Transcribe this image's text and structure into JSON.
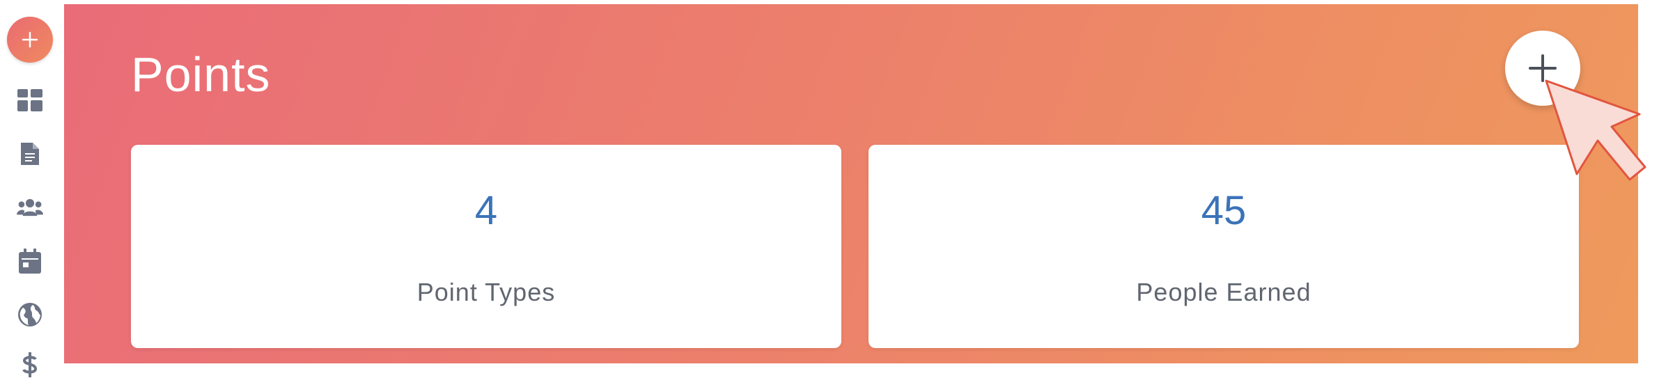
{
  "sidebar": {
    "add_icon": "plus-icon",
    "items": [
      {
        "icon": "dashboard-icon"
      },
      {
        "icon": "document-icon"
      },
      {
        "icon": "people-icon"
      },
      {
        "icon": "calendar-icon"
      },
      {
        "icon": "globe-icon"
      },
      {
        "icon": "dollar-icon"
      }
    ],
    "icon_color": "#6b7385"
  },
  "header": {
    "title": "Points",
    "add_icon": "plus-icon"
  },
  "stats": [
    {
      "value": "4",
      "label": "Point Types"
    },
    {
      "value": "45",
      "label": "People Earned"
    }
  ],
  "colors": {
    "gradient_start": "#e96c78",
    "gradient_end": "#ef9a5c",
    "stat_value": "#3b73b9",
    "stat_label": "#606670"
  }
}
